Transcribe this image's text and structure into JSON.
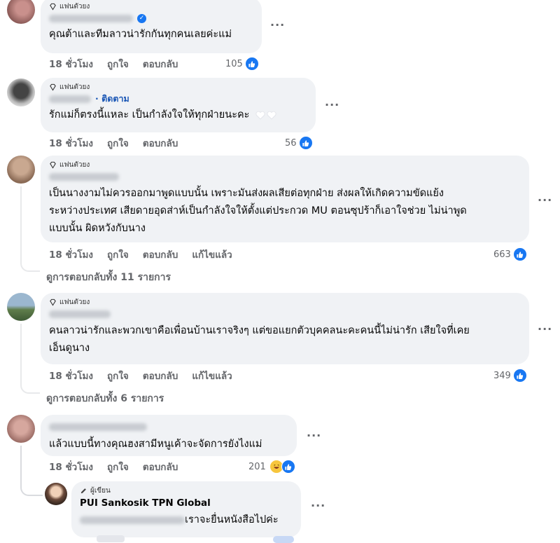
{
  "comments": [
    {
      "badge": "แฟนตัวยง",
      "text": "คุณต้าและทีมลาวน่ารักกันทุกคนเลยค่ะแม่",
      "time": "18 ชั่วโมง",
      "like_label": "ถูกใจ",
      "reply_label": "ตอบกลับ",
      "reactions": "105"
    },
    {
      "badge": "แฟนตัวยง",
      "follow": "· ติดตาม",
      "text": "รักแม่ก็ตรงนี้แหละ เป็นกำลังใจให้ทุกฝ่ายนะคะ",
      "time": "18 ชั่วโมง",
      "like_label": "ถูกใจ",
      "reply_label": "ตอบกลับ",
      "reactions": "56"
    },
    {
      "badge": "แฟนตัวยง",
      "text_lines": [
        "เป็นนางงามไม่ควรออกมาพูดแบบนั้น เพราะมันส่งผลเสียต่อทุกฝ่าย ส่งผลให้เกิดความขัดแย้ง",
        "ระหว่างประเทศ เสียดายอุดส่าห์เป็นกำลังใจให้ตั้งแต่ประกวด MU ตอนซุปร้าก็เอาใจช่วย ไม่น่าพูด",
        "แบบนั้น ผิดหวังกับนาง"
      ],
      "time": "18 ชั่วโมง",
      "like_label": "ถูกใจ",
      "reply_label": "ตอบกลับ",
      "edited_label": "แก้ไขแล้ว",
      "reactions": "663",
      "view_replies": "ดูการตอบกลับทั้ง 11 รายการ"
    },
    {
      "badge": "แฟนตัวยง",
      "text_lines": [
        "คนลาวน่ารักและพวกเขาคือเพื่อนบ้านเราจริงๆ แต่ขอแยกตัวบุคคลนะคะคนนี้ไม่น่ารัก เสียใจที่เคย",
        "เอ็นดูนาง"
      ],
      "time": "18 ชั่วโมง",
      "like_label": "ถูกใจ",
      "reply_label": "ตอบกลับ",
      "edited_label": "แก้ไขแล้ว",
      "reactions": "349",
      "view_replies": "ดูการตอบกลับทั้ง 6 รายการ"
    },
    {
      "text": "แล้วแบบนี้ทางคุณฮงสามีหนูเค้าจะจัดการยังไงแม่",
      "time": "18 ชั่วโมง",
      "like_label": "ถูกใจ",
      "reply_label": "ตอบกลับ",
      "reactions": "201"
    }
  ],
  "reply": {
    "badge": "ผู้เขียน",
    "name": "PUI Sankosik TPN Global",
    "text": "เราจะยื่นหนังสือไปค่ะ"
  },
  "more_label": "···",
  "colors": {
    "accent": "#1877f2",
    "bubble": "#f0f2f5",
    "muted": "#65676b"
  }
}
